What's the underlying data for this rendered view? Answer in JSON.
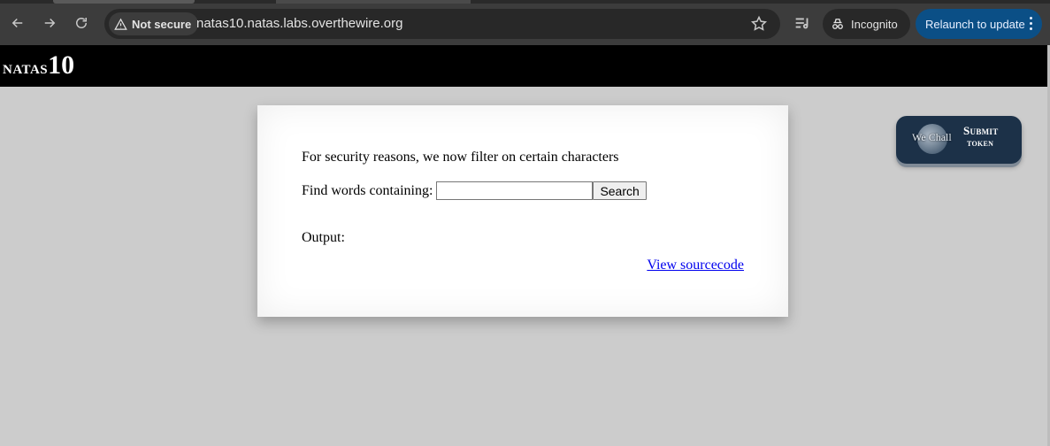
{
  "browser": {
    "security_label": "Not secure",
    "url": "natas10.natas.labs.overthewire.org",
    "incognito_label": "Incognito",
    "relaunch_label": "Relaunch to update"
  },
  "header": {
    "title_word": "natas",
    "title_number": "10"
  },
  "content": {
    "intro": "For security reasons, we now filter on certain characters",
    "find_label": "Find words containing:",
    "search_value": "",
    "search_button": "Search",
    "output_label": "Output:",
    "source_link": "View sourcecode"
  },
  "wechall": {
    "logo_text": "We Chall",
    "line1": "Submit",
    "line2": "token"
  }
}
